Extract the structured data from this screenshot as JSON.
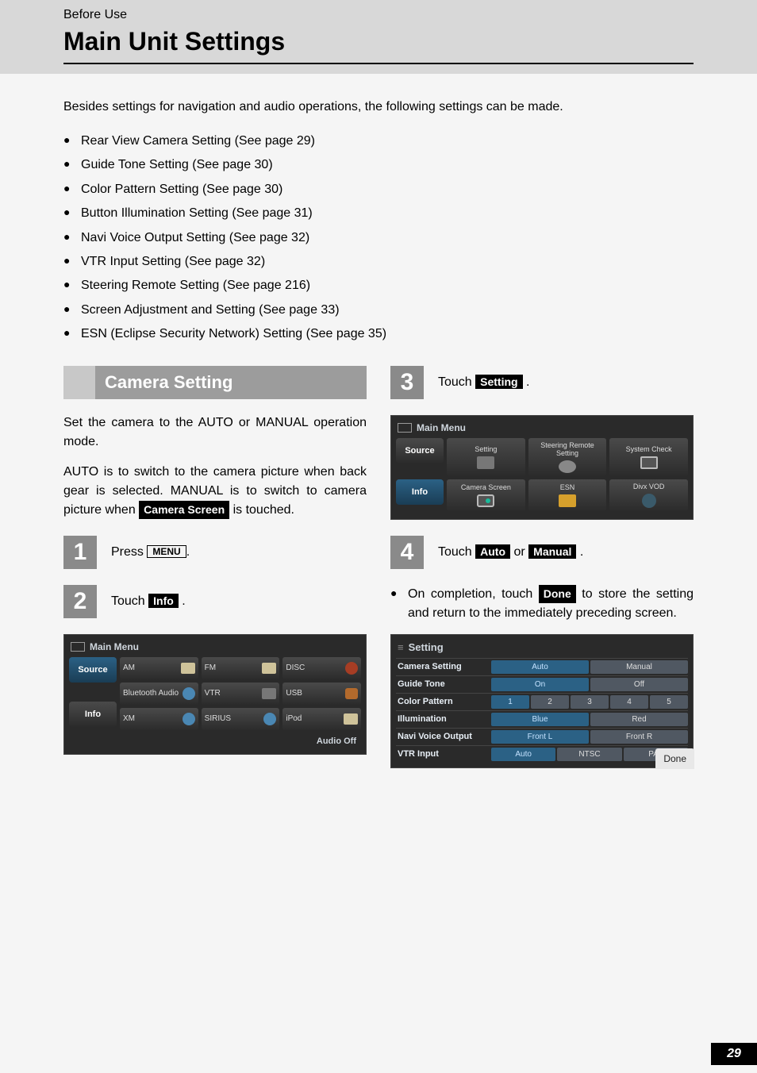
{
  "header": {
    "section_label": "Before Use",
    "title": "Main Unit Settings"
  },
  "intro": "Besides settings for navigation and audio operations, the following settings can be made.",
  "bullet_items": [
    "Rear View Camera Setting (See page 29)",
    "Guide Tone Setting (See page 30)",
    "Color Pattern Setting (See page 30)",
    "Button Illumination Setting (See page 31)",
    "Navi Voice Output Setting (See page 32)",
    "VTR Input Setting (See page 32)",
    "Steering Remote Setting (See page 216)",
    "Screen Adjustment and Setting (See page 33)",
    "ESN (Eclipse Security Network) Setting (See page 35)"
  ],
  "sub_heading": "Camera Setting",
  "para1": "Set the camera to the AUTO or MANUAL operation mode.",
  "para2_a": "AUTO is to switch to the camera picture when back gear is selected. MANUAL is to switch to camera picture when ",
  "para2_btn": "Camera Screen",
  "para2_b": " is touched.",
  "steps": {
    "s1": {
      "num": "1",
      "pre": "Press ",
      "btn": "MENU",
      "post": "."
    },
    "s2": {
      "num": "2",
      "pre": "Touch ",
      "btn": "Info",
      "post": " ."
    },
    "s3": {
      "num": "3",
      "pre": "Touch ",
      "btn": "Setting",
      "post": " ."
    },
    "s4": {
      "num": "4",
      "pre": "Touch ",
      "btn_a": "Auto",
      "mid": " or ",
      "btn_b": "Manual",
      "post": " ."
    }
  },
  "note_pre": "On completion, touch ",
  "note_btn": "Done",
  "note_post": " to store the setting and return to the immediately preceding screen.",
  "device1": {
    "title": "Main Menu",
    "tab_source": "Source",
    "tab_info": "Info",
    "sources": [
      "AM",
      "FM",
      "DISC",
      "Bluetooth Audio",
      "VTR",
      "USB",
      "XM",
      "SIRIUS",
      "iPod"
    ],
    "audio_off": "Audio Off"
  },
  "device2": {
    "title": "Main Menu",
    "tab_source": "Source",
    "tab_info": "Info",
    "tiles": [
      "Setting",
      "Steering Remote Setting",
      "System Check",
      "Camera Screen",
      "ESN",
      "Divx VOD"
    ]
  },
  "settings_panel": {
    "title": "Setting",
    "done": "Done",
    "rows": [
      {
        "label": "Camera Setting",
        "opts": [
          "Auto",
          "Manual"
        ],
        "sel": 0
      },
      {
        "label": "Guide Tone",
        "opts": [
          "On",
          "Off"
        ],
        "sel": 0
      },
      {
        "label": "Color Pattern",
        "opts": [
          "1",
          "2",
          "3",
          "4",
          "5"
        ],
        "sel": 0
      },
      {
        "label": "Illumination",
        "opts": [
          "Blue",
          "Red"
        ],
        "sel": 0
      },
      {
        "label": "Navi Voice Output",
        "opts": [
          "Front L",
          "Front R"
        ],
        "sel": 0
      },
      {
        "label": "VTR Input",
        "opts": [
          "Auto",
          "NTSC",
          "PAL"
        ],
        "sel": 0
      }
    ]
  },
  "page_number": "29"
}
